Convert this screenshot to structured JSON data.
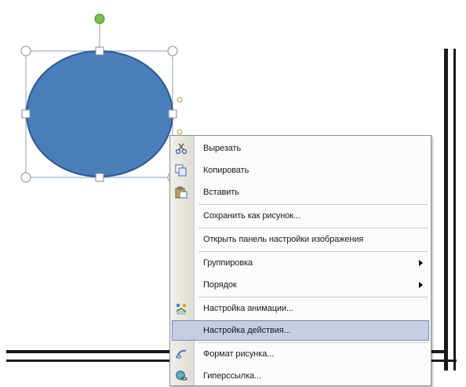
{
  "context_menu": {
    "items": [
      {
        "label": "Вырезать",
        "icon": "scissors-icon"
      },
      {
        "label": "Копировать",
        "icon": "copy-icon"
      },
      {
        "label": "Вставить",
        "icon": "paste-icon"
      },
      {
        "label": "Сохранить как рисунок...",
        "icon": ""
      },
      {
        "label": "Открыть панель настройки изображения",
        "icon": ""
      },
      {
        "label": "Группировка",
        "icon": "",
        "submenu": true
      },
      {
        "label": "Порядок",
        "icon": "",
        "submenu": true
      },
      {
        "label": "Настройка анимации...",
        "icon": "animation-icon"
      },
      {
        "label": "Настройка действия...",
        "icon": "",
        "highlighted": true
      },
      {
        "label": "Формат рисунка...",
        "icon": "format-picture-icon"
      },
      {
        "label": "Гиперссылка...",
        "icon": "hyperlink-icon"
      }
    ]
  },
  "shape": {
    "type": "ellipse",
    "fill_color": "#4a7ebb",
    "stroke_color": "#2e5a8f",
    "rotate_handle_color": "#77c04a",
    "selected": true
  },
  "colors": {
    "menu_highlight": "#c7cde3",
    "menu_gutter": "#e6e4dc"
  }
}
